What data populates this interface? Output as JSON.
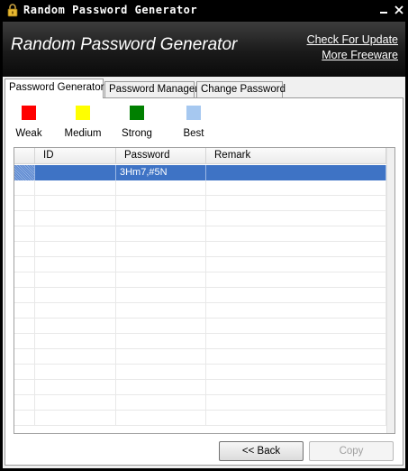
{
  "window": {
    "title": "Random Password Generator"
  },
  "header": {
    "app_title": "Random Password Generator",
    "link_update": "Check For Update",
    "link_freeware": "More Freeware"
  },
  "tabs": [
    {
      "label": "Password Generator",
      "active": true
    },
    {
      "label": "Password Manager",
      "active": false
    },
    {
      "label": "Change Password",
      "active": false
    }
  ],
  "legend": [
    {
      "label": "Weak",
      "color": "#ff0000"
    },
    {
      "label": "Medium",
      "color": "#ffff00"
    },
    {
      "label": "Strong",
      "color": "#008000"
    },
    {
      "label": "Best",
      "color": "#a6c8f0"
    }
  ],
  "grid": {
    "columns": [
      "ID",
      "Password",
      "Remark"
    ],
    "rows": [
      {
        "id": "",
        "password": "3Hm7,#5N",
        "remark": "",
        "selected": true
      }
    ]
  },
  "buttons": {
    "back": "<< Back",
    "copy": "Copy"
  },
  "colors": {
    "selection": "#3e73c5",
    "header_bg": "#1a1a1a"
  }
}
